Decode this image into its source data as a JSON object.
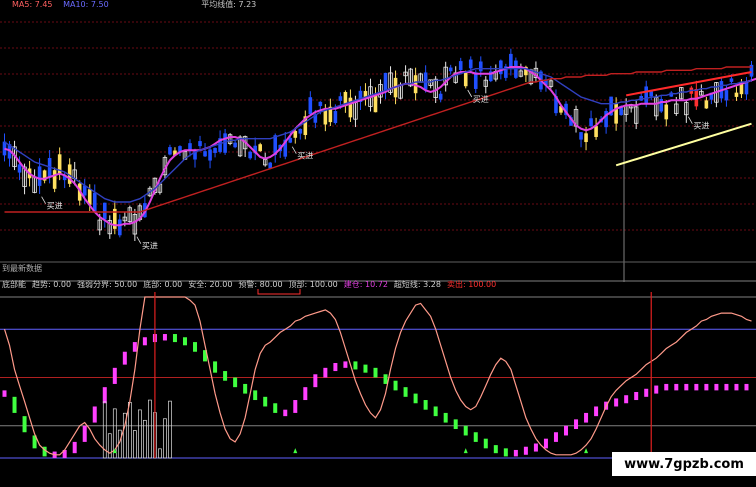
{
  "top_header": {
    "text": "",
    "color": "#ff4040"
  },
  "ma_legend": {
    "ma5": "MA5: 7.45",
    "ma10": "MA10: 7.50",
    "ma5_color": "#ff6060",
    "ma10_color": "#6a6aff",
    "extra": "平均线值: 7.23",
    "extra2": "",
    "extra_color": "#c8c8c8",
    "extra2_color": "#ff3030"
  },
  "price_panel": {
    "annotations": [
      {
        "text": "买进",
        "bar": 8
      },
      {
        "text": "买进",
        "bar": 27
      },
      {
        "text": "买进",
        "bar": 58
      },
      {
        "text": "买进",
        "bar": 93
      },
      {
        "text": "买进",
        "bar": 137
      }
    ],
    "no_data_label": "到最新数据"
  },
  "indicator_legend": [
    {
      "text": "底部能",
      "color": "#d0d0d0"
    },
    {
      "text": "趋势: 0.00",
      "color": "#d0d0d0"
    },
    {
      "text": "强弱分界: 50.00",
      "color": "#d0d0d0"
    },
    {
      "text": "底部: 0.00",
      "color": "#d0d0d0"
    },
    {
      "text": "安全: 20.00",
      "color": "#d0d0d0"
    },
    {
      "text": "预警: 80.00",
      "color": "#d0d0d0"
    },
    {
      "text": "顶部: 100.00",
      "color": "#d0d0d0"
    },
    {
      "text": "建仓: 10.72",
      "color": "#e040e0"
    },
    {
      "text": "超短线: 3.28",
      "color": "#d0d0d0"
    },
    {
      "text": "卖出: 100.00",
      "color": "#ff3030"
    }
  ],
  "watermark": "www.7gpzb.com",
  "colors": {
    "bg": "#000000",
    "up_candle": "#ffe060",
    "up_candle_hollow": "#e8e8e8",
    "down_candle": "#2050ff",
    "red_candle": "#ff3030",
    "ma_pink": "#e040e0",
    "ma_blue": "#3040c0",
    "ma_red": "#c02020",
    "trend_red": "#ff2a2a",
    "trend_yellow": "#ffffa0",
    "grid": "#6a0a14",
    "kdj_salmon": "#ff9a8a",
    "bar_magenta": "#ff40ff",
    "bar_green": "#40ff40",
    "hline_gray": "#808080",
    "hline_blue": "#6060ff",
    "hline_red": "#b02020"
  },
  "chart_data": [
    {
      "type": "line",
      "name": "price",
      "bars": 150,
      "ylim": [
        6.5,
        8.0
      ],
      "series": [
        {
          "name": "MA pink",
          "values": [
            7.18,
            7.17,
            7.14,
            7.1,
            7.06,
            7.03,
            7.01,
            7.0,
            7.0,
            7.01,
            7.02,
            7.03,
            7.02,
            7.0,
            6.97,
            6.93,
            6.88,
            6.84,
            6.8,
            6.77,
            6.75,
            6.73,
            6.72,
            6.72,
            6.73,
            6.73,
            6.74,
            6.76,
            6.8,
            6.86,
            6.93,
            7.0,
            7.06,
            7.11,
            7.14,
            7.16,
            7.17,
            7.17,
            7.17,
            7.17,
            7.18,
            7.19,
            7.21,
            7.23,
            7.24,
            7.25,
            7.25,
            7.24,
            7.22,
            7.19,
            7.16,
            7.13,
            7.12,
            7.13,
            7.15,
            7.18,
            7.22,
            7.26,
            7.3,
            7.33,
            7.36,
            7.38,
            7.4,
            7.41,
            7.42,
            7.42,
            7.42,
            7.43,
            7.44,
            7.45,
            7.46,
            7.47,
            7.48,
            7.49,
            7.5,
            7.51,
            7.52,
            7.54,
            7.55,
            7.56,
            7.57,
            7.57,
            7.56,
            7.55,
            7.53,
            7.52,
            7.53,
            7.55,
            7.58,
            7.61,
            7.63,
            7.64,
            7.64,
            7.64,
            7.63,
            7.63,
            7.63,
            7.63,
            7.64,
            7.65,
            7.66,
            7.67,
            7.67,
            7.67,
            7.66,
            7.64,
            7.62,
            7.59,
            7.56,
            7.53,
            7.49,
            7.44,
            7.4,
            7.36,
            7.32,
            7.3,
            7.29,
            7.3,
            7.32,
            7.35,
            7.38,
            7.4,
            7.42,
            7.43,
            7.44,
            7.44,
            7.44,
            7.45,
            7.45,
            7.45,
            7.45,
            7.46,
            7.46,
            7.47,
            7.47,
            7.47,
            7.47,
            7.48,
            7.48,
            7.49,
            7.5,
            7.51,
            7.52,
            7.53,
            7.54,
            7.55,
            7.56,
            7.57,
            7.58,
            7.59,
            7.6,
            7.61
          ]
        },
        {
          "name": "MA blue",
          "values": [
            7.22,
            7.2,
            7.18,
            7.16,
            7.14,
            7.12,
            7.1,
            7.09,
            7.08,
            7.07,
            7.06,
            7.05,
            7.04,
            7.02,
            7.0,
            6.98,
            6.96,
            6.94,
            6.92,
            6.9,
            6.88,
            6.87,
            6.86,
            6.86,
            6.86,
            6.86,
            6.87,
            6.88,
            6.9,
            6.92,
            6.94,
            6.97,
            7.0,
            7.03,
            7.06,
            7.09,
            7.12,
            7.14,
            7.16,
            7.17,
            7.18,
            7.19,
            7.2,
            7.21,
            7.22,
            7.23,
            7.23,
            7.24,
            7.24,
            7.24,
            7.24,
            7.24,
            7.24,
            7.24,
            7.25,
            7.26,
            7.27,
            7.28,
            7.3,
            7.32,
            7.34,
            7.36,
            7.38,
            7.4,
            7.41,
            7.42,
            7.43,
            7.44,
            7.45,
            7.46,
            7.47,
            7.48,
            7.49,
            7.5,
            7.51,
            7.52,
            7.53,
            7.54,
            7.55,
            7.56,
            7.57,
            7.57,
            7.58,
            7.58,
            7.58,
            7.58,
            7.59,
            7.59,
            7.6,
            7.61,
            7.62,
            7.63,
            7.64,
            7.65,
            7.66,
            7.66,
            7.66,
            7.66,
            7.66,
            7.66,
            7.66,
            7.66,
            7.66,
            7.66,
            7.66,
            7.65,
            7.64,
            7.63,
            7.62,
            7.61,
            7.59,
            7.57,
            7.55,
            7.53,
            7.51,
            7.49,
            7.48,
            7.47,
            7.46,
            7.45,
            7.45,
            7.45,
            7.45,
            7.46,
            7.46,
            7.47,
            7.47,
            7.48,
            7.48,
            7.49,
            7.49,
            7.5,
            7.5,
            7.51,
            7.51,
            7.52,
            7.52,
            7.53,
            7.53,
            7.54,
            7.54,
            7.55,
            7.55,
            7.56,
            7.56,
            7.57,
            7.57,
            7.58,
            7.58,
            7.59
          ]
        },
        {
          "name": "MA red",
          "values": [
            6.8,
            6.8,
            6.8,
            6.8,
            6.8,
            6.8,
            6.8,
            6.8,
            6.8,
            6.8,
            6.8,
            6.8,
            6.8,
            6.8,
            6.8,
            6.8,
            6.8,
            6.8,
            6.8,
            6.8,
            6.8,
            6.8,
            6.8,
            6.8,
            6.8,
            6.8,
            6.8,
            6.8,
            6.81,
            6.82,
            6.83,
            6.84,
            6.85,
            6.86,
            6.87,
            6.88,
            6.89,
            6.9,
            6.91,
            6.92,
            6.93,
            6.94,
            6.95,
            6.96,
            6.97,
            6.98,
            6.99,
            7.0,
            7.01,
            7.02,
            7.03,
            7.04,
            7.05,
            7.06,
            7.07,
            7.08,
            7.09,
            7.1,
            7.11,
            7.12,
            7.13,
            7.14,
            7.15,
            7.16,
            7.17,
            7.18,
            7.19,
            7.2,
            7.21,
            7.22,
            7.23,
            7.24,
            7.25,
            7.26,
            7.27,
            7.28,
            7.29,
            7.3,
            7.31,
            7.32,
            7.33,
            7.34,
            7.35,
            7.36,
            7.37,
            7.38,
            7.39,
            7.4,
            7.41,
            7.42,
            7.43,
            7.44,
            7.45,
            7.46,
            7.47,
            7.48,
            7.49,
            7.5,
            7.51,
            7.52,
            7.53,
            7.54,
            7.55,
            7.56,
            7.57,
            7.58,
            7.58,
            7.59,
            7.59,
            7.6,
            7.6,
            7.6,
            7.61,
            7.61,
            7.61,
            7.61,
            7.62,
            7.62,
            7.62,
            7.62,
            7.62,
            7.63,
            7.63,
            7.63,
            7.63,
            7.63,
            7.64,
            7.64,
            7.64,
            7.64,
            7.64,
            7.64,
            7.65,
            7.65,
            7.65,
            7.65,
            7.65,
            7.65,
            7.66,
            7.66,
            7.66,
            7.66,
            7.66,
            7.66,
            7.67,
            7.67,
            7.67,
            7.67,
            7.67,
            7.67
          ]
        }
      ],
      "trendlines": [
        {
          "name": "resistance",
          "color": "#ff2a2a",
          "from": {
            "bar": 124,
            "y": 7.5
          },
          "to": {
            "bar": 149,
            "y": 7.64
          }
        },
        {
          "name": "support",
          "color": "#ffffa0",
          "from": {
            "bar": 122,
            "y": 7.08
          },
          "to": {
            "bar": 149,
            "y": 7.33
          }
        }
      ]
    },
    {
      "type": "line",
      "name": "indicator",
      "ylim": [
        0,
        100
      ],
      "hlines": [
        {
          "value": 100,
          "color": "#808080"
        },
        {
          "value": 80,
          "color": "#6060ff"
        },
        {
          "value": 50,
          "color": "#b02020"
        },
        {
          "value": 20,
          "color": "#808080"
        },
        {
          "value": 0,
          "color": "#6060ff"
        }
      ],
      "series": [
        {
          "name": "K",
          "values": [
            80,
            70,
            55,
            45,
            35,
            25,
            15,
            8,
            5,
            3,
            2,
            2,
            5,
            10,
            15,
            20,
            22,
            18,
            12,
            8,
            5,
            3,
            5,
            10,
            20,
            35,
            55,
            80,
            100,
            100,
            100,
            100,
            100,
            100,
            100,
            100,
            100,
            98,
            95,
            85,
            70,
            55,
            40,
            28,
            18,
            12,
            10,
            15,
            25,
            40,
            55,
            65,
            70,
            72,
            75,
            78,
            80,
            82,
            85,
            86,
            88,
            89,
            90,
            91,
            92,
            90,
            86,
            78,
            68,
            58,
            48,
            40,
            33,
            28,
            25,
            30,
            40,
            55,
            68,
            78,
            85,
            90,
            95,
            96,
            92,
            88,
            80,
            70,
            60,
            50,
            42,
            36,
            32,
            30,
            32,
            38,
            45,
            52,
            58,
            62,
            60,
            55,
            45,
            35,
            25,
            18,
            12,
            8,
            5,
            3,
            2,
            2,
            2,
            2,
            3,
            5,
            8,
            12,
            18,
            25,
            32,
            38,
            42,
            45,
            48,
            50,
            52,
            55,
            58,
            60,
            62,
            65,
            68,
            70,
            72,
            75,
            78,
            80,
            82,
            85,
            86,
            88,
            89,
            90,
            90,
            90,
            89,
            88,
            86,
            85
          ]
        },
        {
          "name": "bars",
          "values": [
            40,
            36,
            30,
            24,
            18,
            12,
            8,
            5,
            3,
            2,
            2,
            2,
            3,
            5,
            8,
            12,
            18,
            24,
            30,
            36,
            42,
            48,
            54,
            60,
            64,
            68,
            70,
            72,
            73,
            74,
            75,
            75,
            75,
            75,
            74,
            73,
            72,
            70,
            68,
            65,
            62,
            58,
            55,
            52,
            50,
            48,
            46,
            44,
            42,
            40,
            38,
            36,
            34,
            32,
            30,
            28,
            28,
            30,
            34,
            38,
            42,
            46,
            50,
            52,
            54,
            56,
            57,
            58,
            58,
            58,
            57,
            56,
            55,
            54,
            52,
            50,
            48,
            46,
            44,
            42,
            40,
            38,
            36,
            34,
            32,
            30,
            28,
            26,
            24,
            22,
            20,
            18,
            16,
            14,
            12,
            10,
            8,
            6,
            5,
            4,
            3,
            3,
            3,
            4,
            5,
            6,
            7,
            8,
            10,
            12,
            14,
            16,
            18,
            20,
            22,
            24,
            26,
            28,
            30,
            32,
            33,
            34,
            35,
            36,
            37,
            38,
            39,
            40,
            41,
            42,
            43,
            44,
            44,
            44,
            44,
            44,
            44,
            44,
            44,
            44,
            44,
            44,
            44,
            44,
            44,
            44,
            44,
            44,
            44,
            44
          ]
        }
      ],
      "spikes": [
        {
          "bar": 30,
          "value": 100
        },
        {
          "bar": 129,
          "value": 100
        }
      ]
    }
  ]
}
